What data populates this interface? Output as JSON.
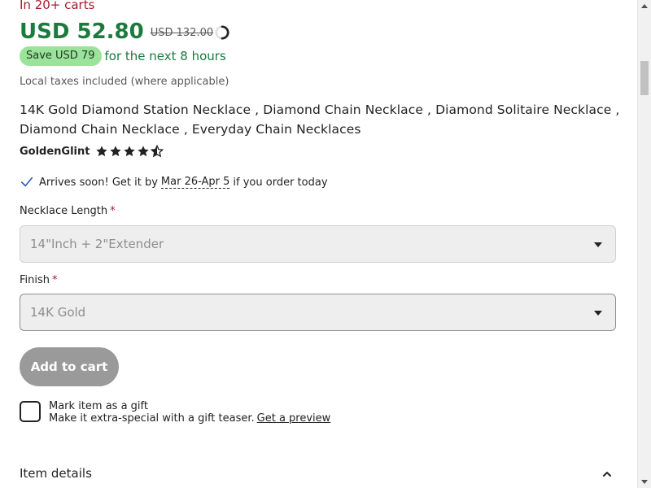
{
  "carts_text": "In 20+ carts",
  "price": {
    "current": "USD 52.80",
    "original": "USD 132.00"
  },
  "savings": {
    "badge": "Save USD 79",
    "suffix": "for the next 8 hours"
  },
  "taxes_note": "Local taxes included (where applicable)",
  "product_title": "14K Gold Diamond Station Necklace , Diamond Chain Necklace , Diamond Solitaire Necklace , Diamond Chain Necklace , Everyday Chain Necklaces",
  "shop": {
    "name": "GoldenGlint",
    "rating": 4.5
  },
  "delivery": {
    "prefix": "Arrives soon! Get it by",
    "date": "Mar 26-Apr 5",
    "suffix": "if you order today"
  },
  "options": {
    "length": {
      "label": "Necklace Length",
      "required_marker": "*",
      "value": "14\"Inch + 2\"Extender"
    },
    "finish": {
      "label": "Finish",
      "required_marker": "*",
      "value": "14K Gold"
    }
  },
  "add_to_cart_label": "Add to cart",
  "gift": {
    "title": "Mark item as a gift",
    "subtitle": "Make it extra-special with a gift teaser.",
    "link": "Get a preview"
  },
  "item_details_label": "Item details",
  "colors": {
    "price_green": "#1b7a3e",
    "alert_red": "#a61a2e",
    "save_badge_bg": "#9be29b",
    "button_disabled": "#9a9a9a"
  },
  "icons": [
    "spinner-icon",
    "star-icon",
    "check-icon",
    "chevron-down-icon",
    "chevron-up-icon"
  ]
}
